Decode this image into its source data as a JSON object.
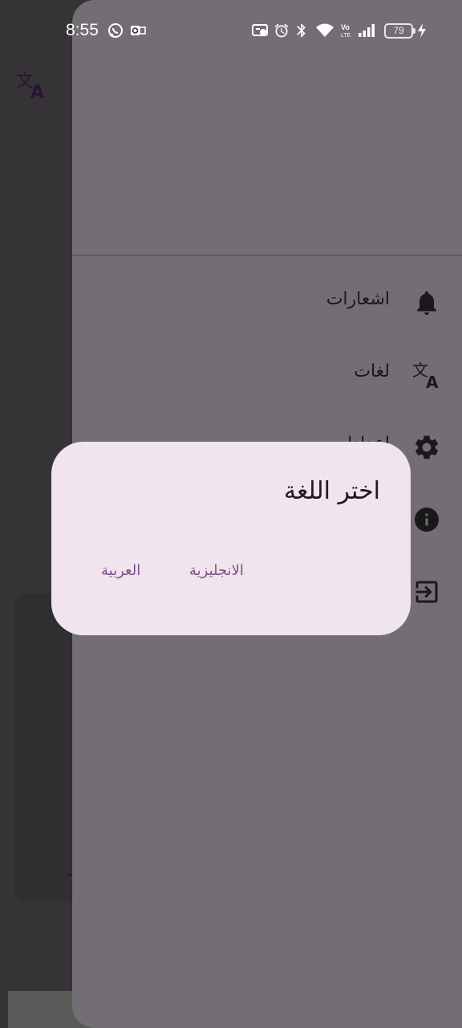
{
  "status_bar": {
    "time": "8:55",
    "battery_level": "79",
    "icons": [
      "whatsapp-icon",
      "outlook-icon",
      "cast-icon",
      "alarm-icon",
      "bluetooth-icon",
      "wifi-icon",
      "volte-icon",
      "signal-icon",
      "battery-icon",
      "charging-icon"
    ]
  },
  "drawer": {
    "menu": [
      {
        "label": "اشعارات",
        "icon": "bell-icon"
      },
      {
        "label": "لغات",
        "icon": "translate-icon"
      },
      {
        "label": "إعدادات",
        "icon": "gear-icon"
      },
      {
        "label": "",
        "icon": "info-icon"
      },
      {
        "label": "",
        "icon": "logout-icon"
      }
    ]
  },
  "dialog": {
    "title": "اختر اللغة",
    "english_button": "الانجليزية",
    "arabic_button": "العربية"
  },
  "colors": {
    "drawer": "#736e73",
    "dialog": "#f0e4ed",
    "accent": "#7d4f86",
    "scrim": "#333133"
  }
}
